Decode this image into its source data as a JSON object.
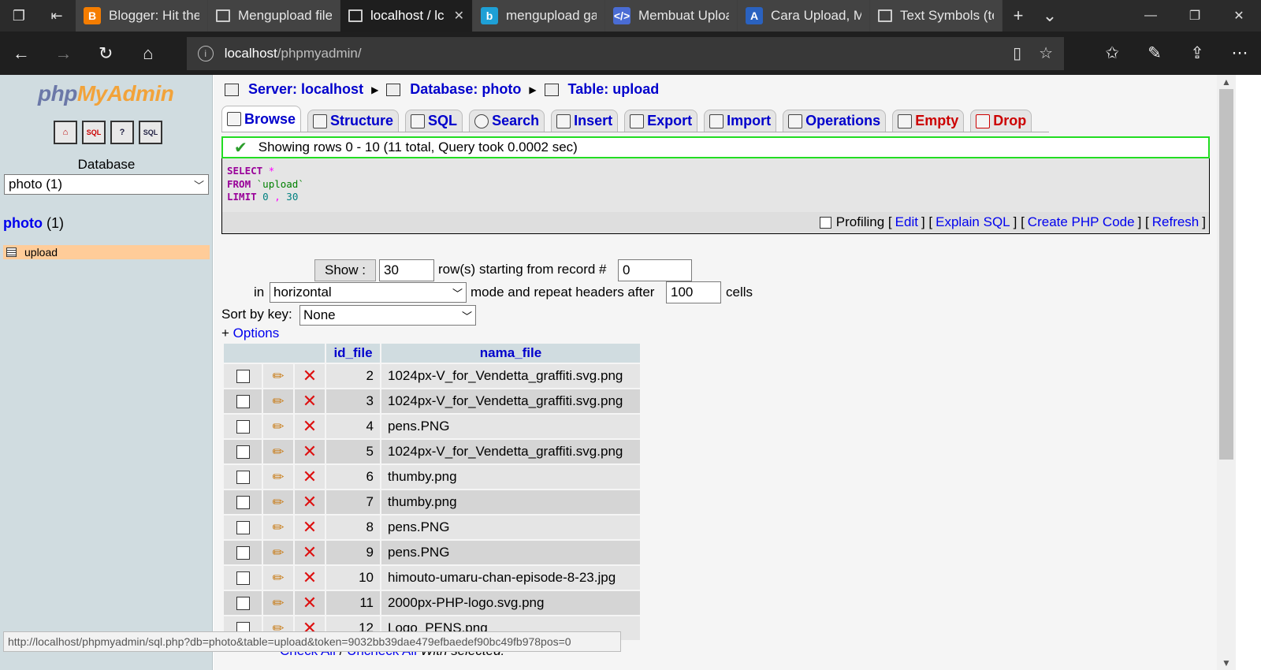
{
  "browser": {
    "tabs": [
      {
        "title": "Blogger: Hit the '",
        "favicon": "B",
        "color": "#f57d00"
      },
      {
        "title": "Mengupload file",
        "favicon": "",
        "color": ""
      },
      {
        "title": "localhost / lc",
        "favicon": "",
        "color": "",
        "active": true
      },
      {
        "title": "mengupload gar",
        "favicon": "b",
        "color": "#1ea0d6"
      },
      {
        "title": "Membuat Uploa",
        "favicon": "</>",
        "color": "#4a6cd4"
      },
      {
        "title": "Cara Upload, Me",
        "favicon": "A",
        "color": "#2a62c0"
      },
      {
        "title": "Text Symbols (te",
        "favicon": "",
        "color": ""
      }
    ],
    "url_host": "localhost",
    "url_path": "/phpmyadmin/"
  },
  "left": {
    "logo_php": "php",
    "logo_my": "My",
    "logo_admin": "Admin",
    "database_label": "Database",
    "database_select": "photo (1)",
    "db_link": "photo",
    "db_count": "(1)",
    "table_item": "upload"
  },
  "breadcrumb": {
    "server": "Server: localhost",
    "database": "Database: photo",
    "table": "Table: upload"
  },
  "tabs": {
    "browse": "Browse",
    "structure": "Structure",
    "sql": "SQL",
    "search": "Search",
    "insert": "Insert",
    "export": "Export",
    "import": "Import",
    "operations": "Operations",
    "empty": "Empty",
    "drop": "Drop"
  },
  "notice": "Showing rows 0 - 10 (11 total, Query took 0.0002 sec)",
  "sql": {
    "select": "SELECT",
    "star": "*",
    "from": "FROM",
    "table": "`upload`",
    "limit": "LIMIT",
    "n0": "0",
    "comma": ",",
    "n30": "30",
    "profiling": "Profiling",
    "edit": "Edit",
    "explain": "Explain SQL",
    "php_code": "Create PHP Code",
    "refresh": "Refresh"
  },
  "navform": {
    "show_btn": "Show :",
    "rows_value": "30",
    "rows_label": "row(s) starting from record #",
    "start_value": "0",
    "in_label": "in",
    "mode_value": "horizontal",
    "mode_label": "mode and repeat headers after",
    "headers_value": "100",
    "cells_label": "cells",
    "sort_label": "Sort by key:",
    "sort_value": "None",
    "options_plus": "+",
    "options_link": "Options"
  },
  "table": {
    "headers": [
      "id_file",
      "nama_file"
    ],
    "rows": [
      {
        "id": "2",
        "name": "1024px-V_for_Vendetta_graffiti.svg.png"
      },
      {
        "id": "3",
        "name": "1024px-V_for_Vendetta_graffiti.svg.png"
      },
      {
        "id": "4",
        "name": "pens.PNG"
      },
      {
        "id": "5",
        "name": "1024px-V_for_Vendetta_graffiti.svg.png"
      },
      {
        "id": "6",
        "name": "thumby.png"
      },
      {
        "id": "7",
        "name": "thumby.png"
      },
      {
        "id": "8",
        "name": "pens.PNG"
      },
      {
        "id": "9",
        "name": "pens.PNG"
      },
      {
        "id": "10",
        "name": "himouto-umaru-chan-episode-8-23.jpg"
      },
      {
        "id": "11",
        "name": "2000px-PHP-logo.svg.png"
      },
      {
        "id": "12",
        "name": "Logo_PENS.png"
      }
    ]
  },
  "bottom": {
    "check_all": "Check All",
    "slash": "/",
    "uncheck_all": "Uncheck All",
    "with_selected": "With selected:"
  },
  "statusbar": "http://localhost/phpmyadmin/sql.php?db=photo&table=upload&token=9032bb39dae479efbaedef90bc49fb978pos=0"
}
